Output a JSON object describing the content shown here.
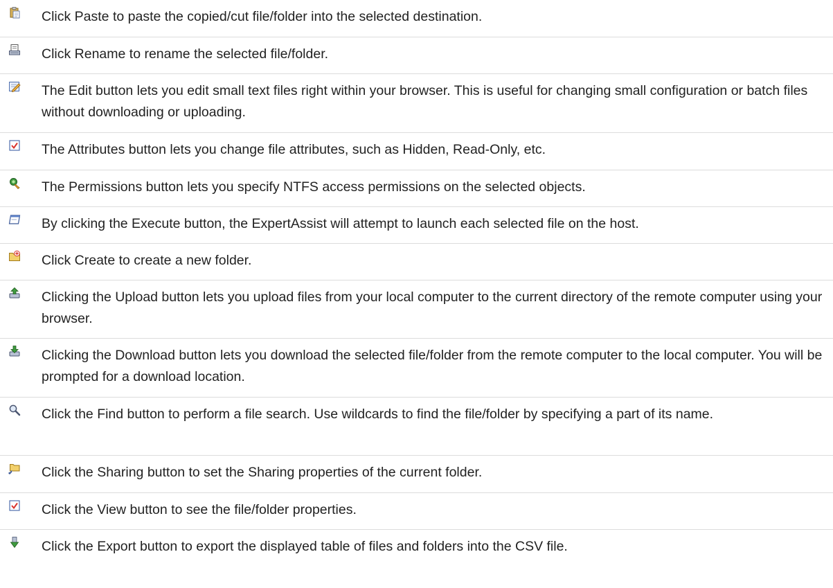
{
  "items": [
    {
      "icon": "paste-icon",
      "text": "Click Paste to paste the copied/cut file/folder into the selected destination."
    },
    {
      "icon": "rename-icon",
      "text": "Click Rename to rename the selected file/folder."
    },
    {
      "icon": "edit-icon",
      "text": "The Edit button lets you edit small text files right within your browser. This is useful for changing small configuration or batch files without downloading or uploading."
    },
    {
      "icon": "attributes-icon",
      "text": "The Attributes button lets you change file attributes, such as Hidden, Read-Only, etc."
    },
    {
      "icon": "permissions-icon",
      "text": "The Permissions button lets you specify NTFS access permissions on the selected objects."
    },
    {
      "icon": "execute-icon",
      "text": "By clicking the Execute button, the ExpertAssist will attempt to launch each selected file on the host."
    },
    {
      "icon": "create-folder-icon",
      "text": "Click Create to create a new folder."
    },
    {
      "icon": "upload-icon",
      "text": "Clicking the Upload button lets you upload files from your local computer to the current directory of the remote computer using your browser."
    },
    {
      "icon": "download-icon",
      "text": "Clicking the Download button lets you download the selected file/folder from the remote computer to the local computer. You will be prompted for a download location."
    },
    {
      "icon": "find-icon",
      "text": "Click the Find button to perform a file search. Use wildcards to find the file/folder by specifying a part of its name."
    },
    {
      "icon": "sharing-icon",
      "text": "Click the Sharing button to set the Sharing properties of the current folder."
    },
    {
      "icon": "view-properties-icon",
      "text": "Click the View button to see the file/folder properties."
    },
    {
      "icon": "export-icon",
      "text": "Click the Export button to export the displayed table of files and folders into the CSV file."
    }
  ]
}
